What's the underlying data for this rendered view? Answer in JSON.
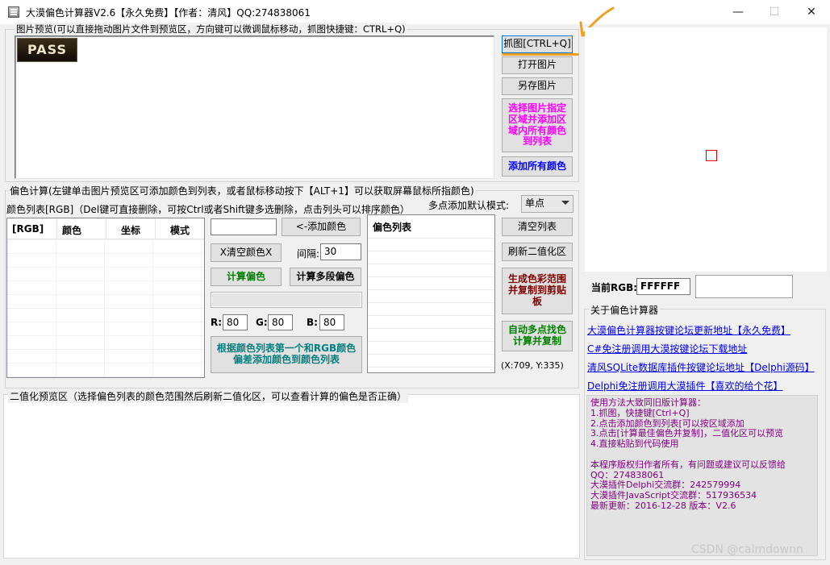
{
  "window": {
    "title": "大漠偏色计算器V2.6【永久免费】【作者：清风】QQ:274838061",
    "minimize_glyph": "—",
    "maximize_glyph": "☐",
    "close_glyph": "✕"
  },
  "preview": {
    "group_label": "图片预览(可以直接拖动图片文件到预览区，方向键可以微调鼠标移动，抓图快捷键：CTRL+Q)",
    "badge_text": "PASS"
  },
  "right_buttons": {
    "capture": "抓图[CTRL+Q]",
    "open": "打开图片",
    "save_as": "另存图片",
    "select_region": "选择图片指定区域并添加区域内所有颜色到列表",
    "add_all": "添加所有颜色"
  },
  "calc": {
    "group_label": "偏色计算(左键单击图片预览区可添加颜色到列表，或者鼠标移动按下【ALT+1】可以获取屏幕鼠标所指颜色)",
    "list_label": "颜色列表[RGB]（Del键可直接删除，可按Ctrl或者Shift键多选删除，点击列头可以排序颜色）",
    "multipoint_label": "多点添加默认模式:",
    "multipoint_mode": "单点",
    "columns": [
      "[RGB]",
      "颜色",
      "坐标",
      "模式"
    ],
    "color_input_value": "",
    "add_color": "<-添加颜色",
    "clear_color": "X清空颜色X",
    "interval_label": "间隔:",
    "interval_value": "30",
    "calc_offset": "计算偏色",
    "calc_multi": "计算多段偏色",
    "r_label": "R:",
    "r_value": "80",
    "g_label": "G:",
    "g_value": "80",
    "b_label": "B:",
    "b_value": "80",
    "add_by_rgb": "根据颜色列表第一个和RGB颜色偏差添加颜色到颜色列表",
    "colorlist_header": "偏色列表",
    "clear_list": "清空列表",
    "refresh_binary": "刷新二值化区",
    "gen_range": "生成色彩范围并复制到剪贴板",
    "auto_multipoint": "自动多点找色计算并复制",
    "coords": "(X:709, Y:335)"
  },
  "binary": {
    "group_label": "二值化预览区（选择偏色列表的颜色范围然后刷新二值化区，可以查看计算的偏色是否正确）"
  },
  "current": {
    "label": "当前RGB:",
    "value": "FFFFFF",
    "swatch_color": "#ffffff"
  },
  "about": {
    "group_label": "关于偏色计算器",
    "links": [
      "大漠偏色计算器按键论坛更新地址【永久免费】",
      "C#免注册调用大漠按键论坛下载地址",
      "清风SQLite数据库插件按键论坛地址【Delphi源码】",
      "Delphi免注册调用大漠插件【喜欢的给个花】"
    ],
    "info_lines": [
      "使用方法大致同旧版计算器：",
      "1.抓图，快捷键[Ctrl+Q]",
      "2.点击添加颜色到列表[可以按区域添加",
      "3.点击[计算最佳偏色并复制]，二值化区可以预览",
      "4.直接粘贴到代码使用",
      "",
      "本程序版权归作者所有，有问题或建议可以反馈给",
      "QQ：274838061",
      "大漠插件Delphi交流群：242579994",
      "大漠插件JavaScript交流群：517936534",
      "最新更新：2016-12-28 版本：V2.6"
    ]
  },
  "watermark": "CSDN @calmdownn",
  "colors": {
    "annotation_orange": "#f0a020",
    "marker_red": "#e00000"
  }
}
